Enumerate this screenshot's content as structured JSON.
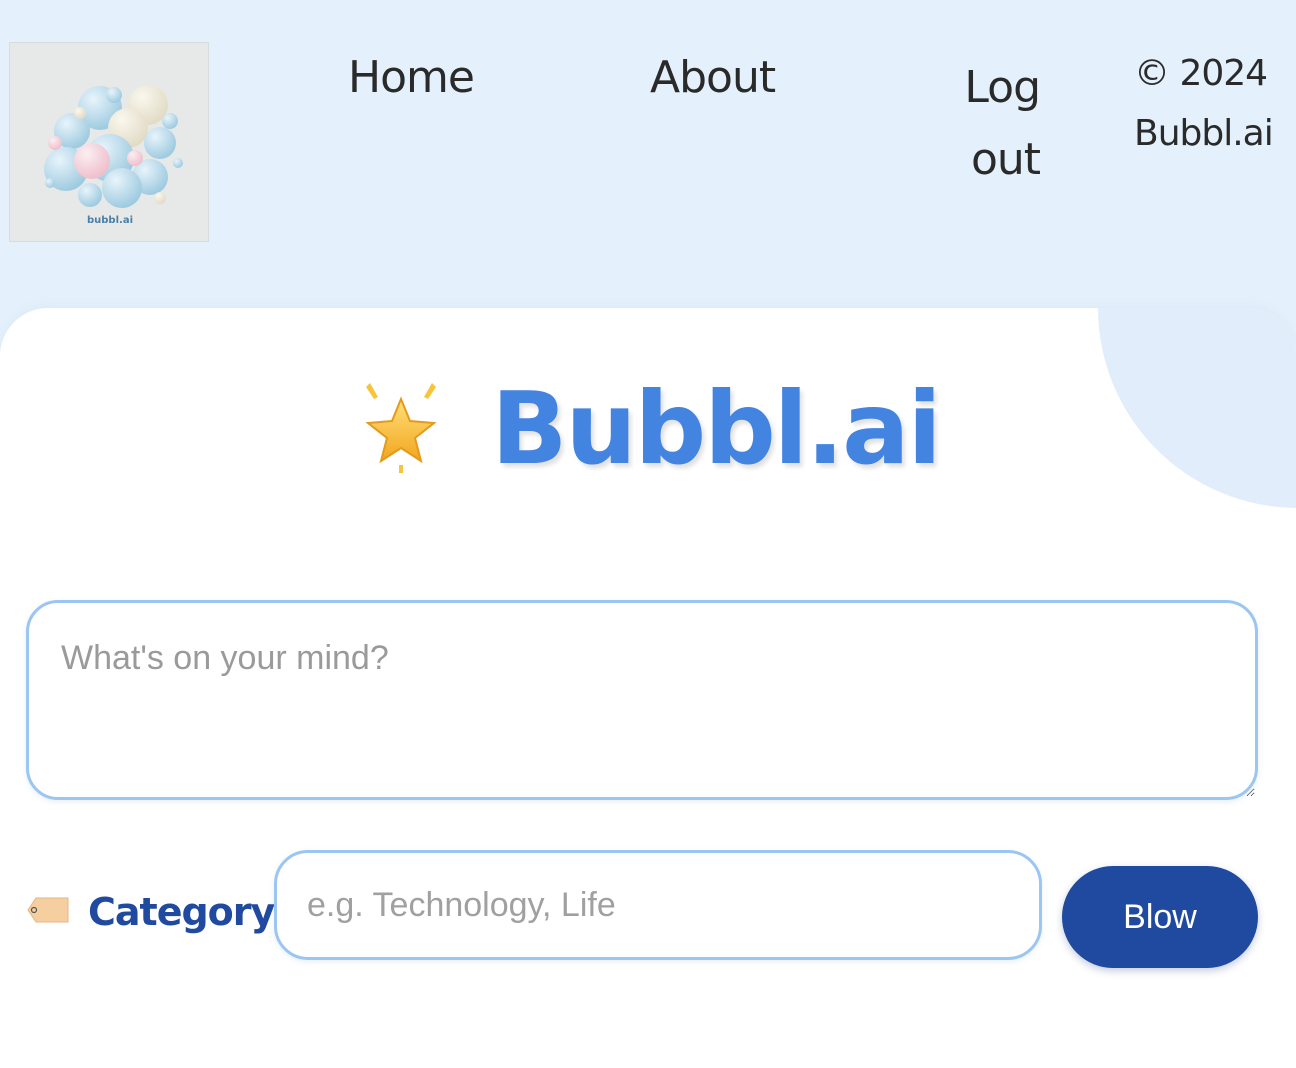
{
  "header": {
    "logo_text": "bubbl.ai",
    "nav": {
      "home": "Home",
      "about": "About",
      "logout": "Log out"
    },
    "copyright_line1": "© 2024",
    "copyright_line2": "Bubbl.ai"
  },
  "main": {
    "brand_icon": "glowing-star-icon",
    "brand_title": "Bubbl.ai",
    "thought_placeholder": "What's on your mind?",
    "category": {
      "icon": "tag-icon",
      "label": "Category",
      "placeholder": "e.g. Technology, Life"
    },
    "submit_label": "Blow"
  },
  "colors": {
    "header_bg": "#e4f1fc",
    "brand_blue": "#4384e0",
    "dark_blue": "#1f4aa0",
    "input_border": "#9cc6f2"
  }
}
